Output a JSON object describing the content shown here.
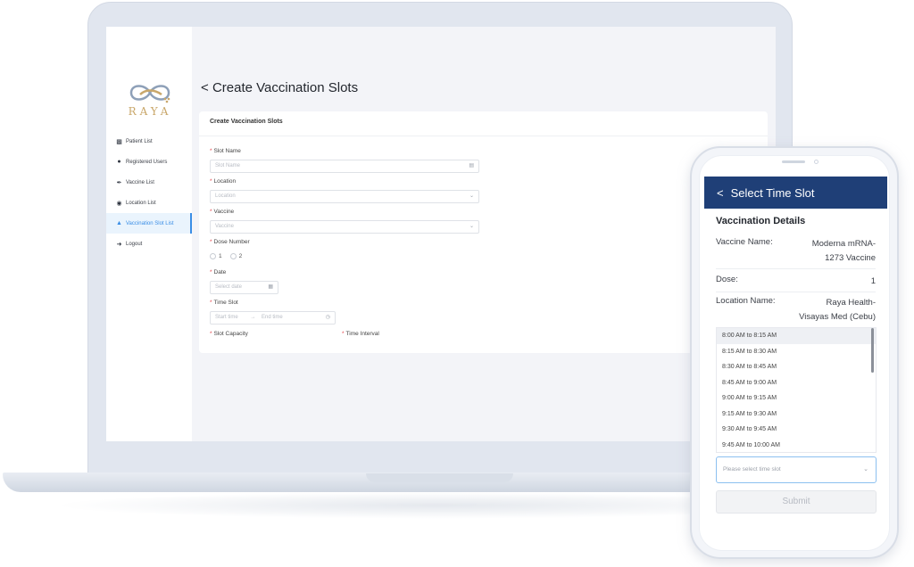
{
  "brand": {
    "logo_text": "RAYA",
    "accent": "#3a8ee6",
    "header_color": "#1f3f77",
    "gold": "#c9a76a"
  },
  "sidebar": {
    "items": [
      {
        "icon": "patient-list-icon",
        "label": "Patient List",
        "active": false
      },
      {
        "icon": "user-icon",
        "label": "Registered Users",
        "active": false
      },
      {
        "icon": "syringe-icon",
        "label": "Vaccine List",
        "active": false
      },
      {
        "icon": "location-pin-icon",
        "label": "Location List",
        "active": false
      },
      {
        "icon": "building-icon",
        "label": "Vaccination Slot List",
        "active": true
      },
      {
        "icon": "logout-icon",
        "label": "Logout",
        "active": false
      }
    ]
  },
  "page": {
    "back_glyph": "<",
    "title": "Create Vaccination Slots"
  },
  "form": {
    "card_title": "Create Vaccination Slots",
    "slot_name": {
      "label": "Slot Name",
      "placeholder": "Slot Name"
    },
    "location": {
      "label": "Location",
      "placeholder": "Location"
    },
    "vaccine": {
      "label": "Vaccine",
      "placeholder": "Vaccine"
    },
    "dose_number": {
      "label": "Dose Number",
      "options": [
        "1",
        "2"
      ]
    },
    "date": {
      "label": "Date",
      "placeholder": "Select date"
    },
    "time_slot": {
      "label": "Time Slot",
      "start_placeholder": "Start time",
      "end_placeholder": "End time"
    },
    "slot_capacity": {
      "label": "Slot Capacity"
    },
    "time_interval": {
      "label": "Time Interval"
    }
  },
  "mobile": {
    "header_title": "Select Time Slot",
    "section_title": "Vaccination Details",
    "details": [
      {
        "key": "Vaccine Name:",
        "value_lines": [
          "Moderna mRNA-",
          "1273 Vaccine"
        ]
      },
      {
        "key": "Dose:",
        "value_lines": [
          "1"
        ]
      },
      {
        "key": "Location Name:",
        "value_lines": [
          "Raya Health-",
          "Visayas Med (Cebu)"
        ]
      }
    ],
    "slots": [
      "8:00 AM to 8:15 AM",
      "8:15 AM to 8:30 AM",
      "8:30 AM to 8:45 AM",
      "8:45 AM to 9:00 AM",
      "9:00 AM to 9:15 AM",
      "9:15 AM to 9:30 AM",
      "9:30 AM to 9:45 AM",
      "9:45 AM to 10:00 AM"
    ],
    "select_placeholder": "Please select time slot",
    "submit_label": "Submit"
  }
}
